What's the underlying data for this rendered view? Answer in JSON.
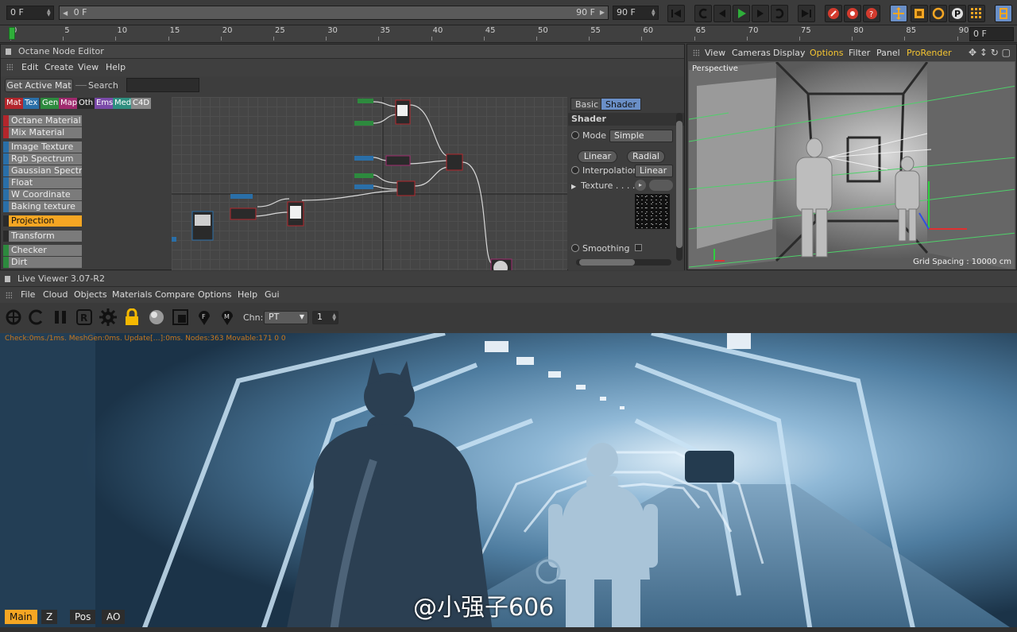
{
  "timeline": {
    "start_frame": "0 F",
    "range_start": "0 F",
    "range_end": "90 F",
    "end_frame": "90 F",
    "current_frame": "0 F",
    "ruler_ticks": [
      "0",
      "5",
      "10",
      "15",
      "20",
      "25",
      "30",
      "35",
      "40",
      "45",
      "50",
      "55",
      "60",
      "65",
      "70",
      "75",
      "80",
      "85",
      "90"
    ]
  },
  "node_editor": {
    "title": "Octane Node Editor",
    "menu": [
      "Edit",
      "Create",
      "View",
      "Help"
    ],
    "get_active_mat": "Get Active Mat",
    "search_label": "Search",
    "search_value": "",
    "categories": [
      {
        "label": "Mat",
        "color": "#b3262c"
      },
      {
        "label": "Tex",
        "color": "#2a6fa8"
      },
      {
        "label": "Gen",
        "color": "#2d8a3e"
      },
      {
        "label": "Map",
        "color": "#a02a6e"
      },
      {
        "label": "Oth",
        "color": "#2a2a2a"
      },
      {
        "label": "Ems",
        "color": "#7a4aa8"
      },
      {
        "label": "Med",
        "color": "#2f8f80"
      },
      {
        "label": "C4D",
        "color": "#8a8a8a"
      }
    ],
    "nodes": [
      {
        "label": "Octane Material",
        "color": "#b3262c"
      },
      {
        "label": "Mix Material",
        "color": "#b3262c"
      },
      {
        "label": "Image Texture",
        "color": "#2a6fa8"
      },
      {
        "label": "Rgb Spectrum",
        "color": "#2a6fa8"
      },
      {
        "label": "Gaussian Spectrum",
        "color": "#2a6fa8"
      },
      {
        "label": "Float",
        "color": "#2a6fa8"
      },
      {
        "label": "W Coordinate",
        "color": "#2a6fa8"
      },
      {
        "label": "Baking texture",
        "color": "#2a6fa8"
      },
      {
        "label": "Projection",
        "color": "#2a2a2a",
        "selected": true
      },
      {
        "label": "Transform",
        "color": "#2a2a2a"
      },
      {
        "label": "Checker",
        "color": "#2d8a3e"
      },
      {
        "label": "Dirt",
        "color": "#2d8a3e"
      }
    ],
    "shader_panel": {
      "tabs": [
        "Basic",
        "Shader"
      ],
      "active_tab": "Shader",
      "heading": "Shader",
      "mode_label": "Mode",
      "mode_value": "Simple",
      "linear_button": "Linear",
      "radial_button": "Radial",
      "interpolation_label": "Interpolation",
      "interpolation_value": "Linear",
      "texture_label": "Texture . . . .",
      "smoothing_label": "Smoothing"
    }
  },
  "viewport": {
    "menu": [
      "View",
      "Cameras",
      "Display",
      "Options",
      "Filter",
      "Panel",
      "ProRender"
    ],
    "highlighted_menu": "Options",
    "view_name": "Perspective",
    "grid_spacing": "Grid Spacing : 10000 cm"
  },
  "live_viewer": {
    "title": "Live Viewer 3.07-R2",
    "menu": [
      "File",
      "Cloud",
      "Objects",
      "Materials",
      "Compare",
      "Options",
      "Help",
      "Gui"
    ],
    "channel_label": "Chn:",
    "channel_value": "PT",
    "channel_number": "1",
    "status_line": "Check:0ms./1ms. MeshGen:0ms. Update[…]:0ms. Nodes:363 Movable:171  0 0",
    "bottom_tabs": [
      "Main",
      "Z",
      "Pos",
      "AO"
    ],
    "active_bottom_tab": "Main",
    "watermark": "@小强子606"
  },
  "colors": {
    "accent_orange": "#f5a623",
    "highlight_blue": "#6a8fc7",
    "play_green": "#2fae3a",
    "record_red": "#d23b2e"
  }
}
